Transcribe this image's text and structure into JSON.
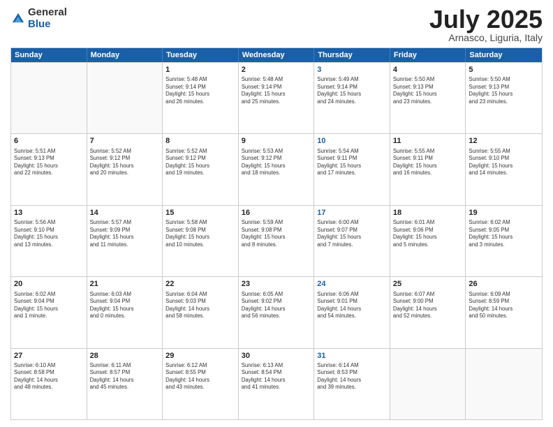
{
  "logo": {
    "general": "General",
    "blue": "Blue"
  },
  "title": "July 2025",
  "location": "Arnasco, Liguria, Italy",
  "header_days": [
    "Sunday",
    "Monday",
    "Tuesday",
    "Wednesday",
    "Thursday",
    "Friday",
    "Saturday"
  ],
  "rows": [
    [
      {
        "day": "",
        "info": ""
      },
      {
        "day": "",
        "info": ""
      },
      {
        "day": "1",
        "info": "Sunrise: 5:48 AM\nSunset: 9:14 PM\nDaylight: 15 hours\nand 26 minutes."
      },
      {
        "day": "2",
        "info": "Sunrise: 5:48 AM\nSunset: 9:14 PM\nDaylight: 15 hours\nand 25 minutes."
      },
      {
        "day": "3",
        "info": "Sunrise: 5:49 AM\nSunset: 9:14 PM\nDaylight: 15 hours\nand 24 minutes."
      },
      {
        "day": "4",
        "info": "Sunrise: 5:50 AM\nSunset: 9:13 PM\nDaylight: 15 hours\nand 23 minutes."
      },
      {
        "day": "5",
        "info": "Sunrise: 5:50 AM\nSunset: 9:13 PM\nDaylight: 15 hours\nand 23 minutes."
      }
    ],
    [
      {
        "day": "6",
        "info": "Sunrise: 5:51 AM\nSunset: 9:13 PM\nDaylight: 15 hours\nand 22 minutes."
      },
      {
        "day": "7",
        "info": "Sunrise: 5:52 AM\nSunset: 9:12 PM\nDaylight: 15 hours\nand 20 minutes."
      },
      {
        "day": "8",
        "info": "Sunrise: 5:52 AM\nSunset: 9:12 PM\nDaylight: 15 hours\nand 19 minutes."
      },
      {
        "day": "9",
        "info": "Sunrise: 5:53 AM\nSunset: 9:12 PM\nDaylight: 15 hours\nand 18 minutes."
      },
      {
        "day": "10",
        "info": "Sunrise: 5:54 AM\nSunset: 9:11 PM\nDaylight: 15 hours\nand 17 minutes."
      },
      {
        "day": "11",
        "info": "Sunrise: 5:55 AM\nSunset: 9:11 PM\nDaylight: 15 hours\nand 16 minutes."
      },
      {
        "day": "12",
        "info": "Sunrise: 5:55 AM\nSunset: 9:10 PM\nDaylight: 15 hours\nand 14 minutes."
      }
    ],
    [
      {
        "day": "13",
        "info": "Sunrise: 5:56 AM\nSunset: 9:10 PM\nDaylight: 15 hours\nand 13 minutes."
      },
      {
        "day": "14",
        "info": "Sunrise: 5:57 AM\nSunset: 9:09 PM\nDaylight: 15 hours\nand 11 minutes."
      },
      {
        "day": "15",
        "info": "Sunrise: 5:58 AM\nSunset: 9:08 PM\nDaylight: 15 hours\nand 10 minutes."
      },
      {
        "day": "16",
        "info": "Sunrise: 5:59 AM\nSunset: 9:08 PM\nDaylight: 15 hours\nand 8 minutes."
      },
      {
        "day": "17",
        "info": "Sunrise: 6:00 AM\nSunset: 9:07 PM\nDaylight: 15 hours\nand 7 minutes."
      },
      {
        "day": "18",
        "info": "Sunrise: 6:01 AM\nSunset: 9:06 PM\nDaylight: 15 hours\nand 5 minutes."
      },
      {
        "day": "19",
        "info": "Sunrise: 6:02 AM\nSunset: 9:05 PM\nDaylight: 15 hours\nand 3 minutes."
      }
    ],
    [
      {
        "day": "20",
        "info": "Sunrise: 6:02 AM\nSunset: 9:04 PM\nDaylight: 15 hours\nand 1 minute."
      },
      {
        "day": "21",
        "info": "Sunrise: 6:03 AM\nSunset: 9:04 PM\nDaylight: 15 hours\nand 0 minutes."
      },
      {
        "day": "22",
        "info": "Sunrise: 6:04 AM\nSunset: 9:03 PM\nDaylight: 14 hours\nand 58 minutes."
      },
      {
        "day": "23",
        "info": "Sunrise: 6:05 AM\nSunset: 9:02 PM\nDaylight: 14 hours\nand 56 minutes."
      },
      {
        "day": "24",
        "info": "Sunrise: 6:06 AM\nSunset: 9:01 PM\nDaylight: 14 hours\nand 54 minutes."
      },
      {
        "day": "25",
        "info": "Sunrise: 6:07 AM\nSunset: 9:00 PM\nDaylight: 14 hours\nand 52 minutes."
      },
      {
        "day": "26",
        "info": "Sunrise: 6:09 AM\nSunset: 8:59 PM\nDaylight: 14 hours\nand 50 minutes."
      }
    ],
    [
      {
        "day": "27",
        "info": "Sunrise: 6:10 AM\nSunset: 8:58 PM\nDaylight: 14 hours\nand 48 minutes."
      },
      {
        "day": "28",
        "info": "Sunrise: 6:11 AM\nSunset: 8:57 PM\nDaylight: 14 hours\nand 45 minutes."
      },
      {
        "day": "29",
        "info": "Sunrise: 6:12 AM\nSunset: 8:55 PM\nDaylight: 14 hours\nand 43 minutes."
      },
      {
        "day": "30",
        "info": "Sunrise: 6:13 AM\nSunset: 8:54 PM\nDaylight: 14 hours\nand 41 minutes."
      },
      {
        "day": "31",
        "info": "Sunrise: 6:14 AM\nSunset: 8:53 PM\nDaylight: 14 hours\nand 39 minutes."
      },
      {
        "day": "",
        "info": ""
      },
      {
        "day": "",
        "info": ""
      }
    ]
  ]
}
